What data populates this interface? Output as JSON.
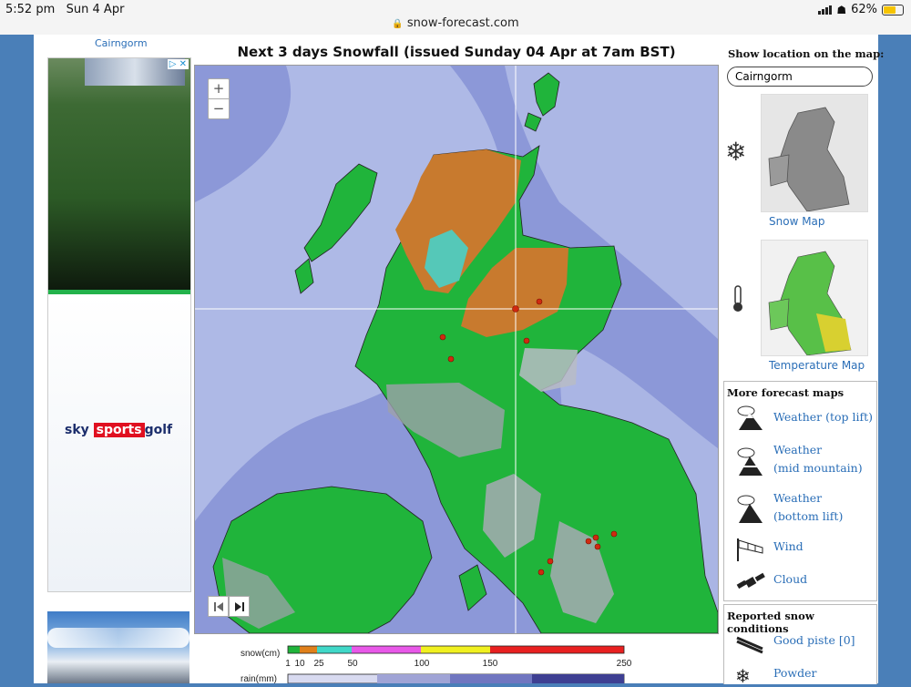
{
  "status": {
    "time": "5:52 pm",
    "date": "Sun 4 Apr",
    "url": "snow-forecast.com",
    "battery": "62%"
  },
  "left": {
    "location_caption": "Cairngorm",
    "ad_brand_1": "sky",
    "ad_brand_2": "sports",
    "ad_brand_3": "golf"
  },
  "map": {
    "title": "Next 3 days Snowfall (issued Sunday 04 Apr at 7am BST)",
    "zoom_in": "+",
    "zoom_out": "−",
    "legend": {
      "snow_label": "snow(cm)",
      "rain_label": "rain(mm)",
      "snow_ticks": [
        "1",
        "10",
        "25",
        "50",
        "100",
        "150",
        "250"
      ]
    }
  },
  "sidebar": {
    "show_location_label": "Show location on the map:",
    "location_value": "Cairngorm",
    "snow_map_label": "Snow Map",
    "temp_map_label": "Temperature Map",
    "more_maps_heading": "More forecast maps",
    "more_maps": [
      {
        "line1": "Weather (top lift)",
        "line2": ""
      },
      {
        "line1": "Weather",
        "line2": "(mid mountain)"
      },
      {
        "line1": "Weather",
        "line2": "(bottom lift)"
      },
      {
        "line1": "Wind",
        "line2": ""
      },
      {
        "line1": "Cloud",
        "line2": ""
      }
    ],
    "reported_heading": "Reported snow conditions",
    "reported": [
      "Good piste [0]",
      "Powder"
    ]
  }
}
